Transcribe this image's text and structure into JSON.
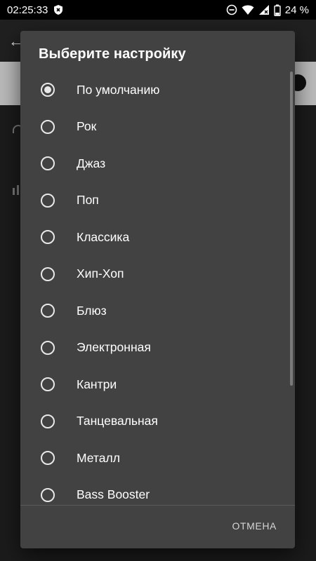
{
  "status_bar": {
    "time": "02:25:33",
    "battery": "24 %",
    "icons": [
      "shield-icon",
      "dnd-icon",
      "wifi-icon",
      "signal-icon",
      "battery-icon"
    ]
  },
  "dialog": {
    "title": "Выберите настройку",
    "options": [
      {
        "label": "По умолчанию",
        "selected": true
      },
      {
        "label": "Рок",
        "selected": false
      },
      {
        "label": "Джаз",
        "selected": false
      },
      {
        "label": "Поп",
        "selected": false
      },
      {
        "label": "Классика",
        "selected": false
      },
      {
        "label": "Хип-Хоп",
        "selected": false
      },
      {
        "label": "Блюз",
        "selected": false
      },
      {
        "label": "Электронная",
        "selected": false
      },
      {
        "label": "Кантри",
        "selected": false
      },
      {
        "label": "Танцевальная",
        "selected": false
      },
      {
        "label": "Металл",
        "selected": false
      },
      {
        "label": "Bass Booster",
        "selected": false
      }
    ],
    "cancel_label": "ОТМЕНА"
  },
  "colors": {
    "dialog_bg": "#424242",
    "text": "#ffffff",
    "radio": "#e8e8e8"
  }
}
